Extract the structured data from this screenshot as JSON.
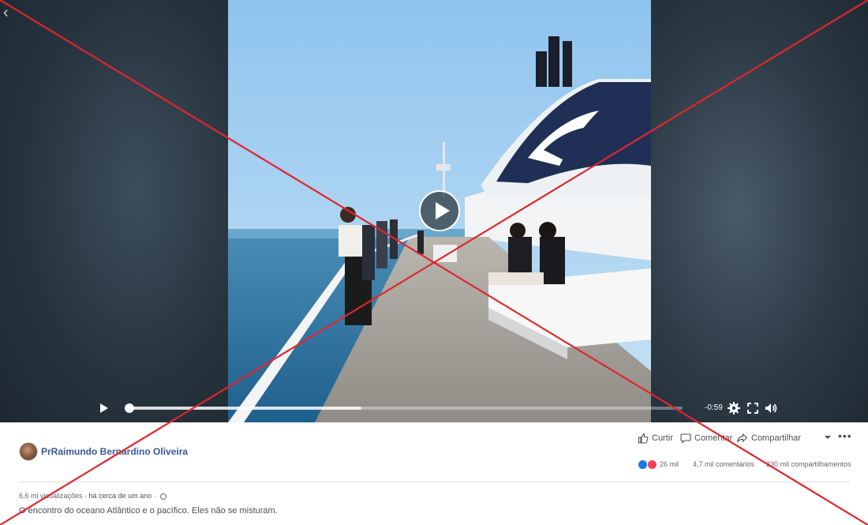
{
  "video": {
    "time_remaining": "-0:59",
    "progress_buffered": 0.42,
    "progress_played": 0.0,
    "icons": [
      "back-arrow-icon",
      "play-icon",
      "gear-icon",
      "fullscreen-icon",
      "volume-icon"
    ]
  },
  "post": {
    "author": "PrRaimundo Bernardino Oliveira",
    "actions": {
      "like": "Curtir",
      "comment": "Comentar",
      "share": "Compartilhar"
    },
    "stats": {
      "reactions": "26 mil",
      "comments": "4,7 mil comentários",
      "shares": "330 mil compartilhamentos"
    },
    "views": "6,6 mi visualizações",
    "separator": " · ",
    "time": "há cerca de um ano",
    "caption": "O encontro do oceano Atlântico e o pacífico. Eles não se misturam."
  },
  "overlay": {
    "x_color": "#e0262e"
  }
}
